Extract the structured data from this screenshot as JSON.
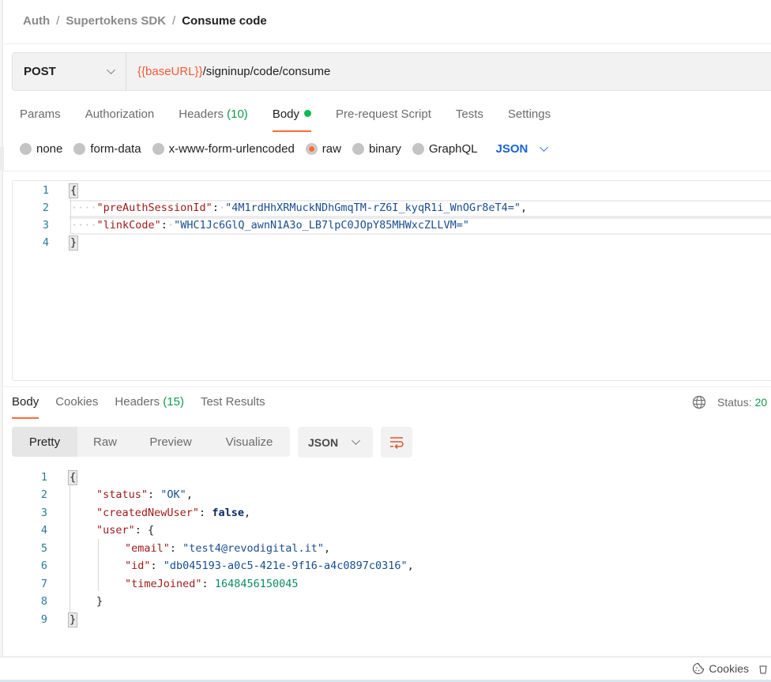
{
  "breadcrumb": {
    "items": [
      "Auth",
      "Supertokens SDK"
    ],
    "separator": "/",
    "current": "Consume code"
  },
  "request": {
    "method": "POST",
    "url_variable": "{{baseURL}}",
    "url_path": "/signinup/code/consume"
  },
  "request_tabs": [
    {
      "label": "Params"
    },
    {
      "label": "Authorization"
    },
    {
      "label": "Headers",
      "count": "(10)"
    },
    {
      "label": "Body",
      "active": true,
      "indicator": "green-dot"
    },
    {
      "label": "Pre-request Script"
    },
    {
      "label": "Tests"
    },
    {
      "label": "Settings"
    }
  ],
  "body_types": {
    "options": [
      "none",
      "form-data",
      "x-www-form-urlencoded",
      "raw",
      "binary",
      "GraphQL"
    ],
    "selected": "raw",
    "language": "JSON"
  },
  "request_body": {
    "lines": [
      {
        "n": "1",
        "open": "{"
      },
      {
        "n": "2",
        "key": "\"preAuthSessionId\"",
        "value": "\"4M1rdHhXRMuckNDhGmqTM-rZ6I_kyqR1i_WnOGr8eT4=\"",
        "trail": ","
      },
      {
        "n": "3",
        "key": "\"linkCode\"",
        "value": "\"WHC1Jc6GlQ_awnN1A3o_LB7lpC0JOpY85MHWxcZLLVM=\"",
        "trail": ""
      },
      {
        "n": "4",
        "close": "}"
      }
    ]
  },
  "response_tabs": [
    {
      "label": "Body",
      "active": true
    },
    {
      "label": "Cookies"
    },
    {
      "label": "Headers",
      "count": "(15)"
    },
    {
      "label": "Test Results"
    }
  ],
  "response_status": {
    "label": "Status:",
    "value": "20"
  },
  "response_view": {
    "modes": [
      "Pretty",
      "Raw",
      "Preview",
      "Visualize"
    ],
    "selected": "Pretty",
    "format": "JSON"
  },
  "response_body": {
    "lines": [
      {
        "n": "1",
        "text": "{"
      },
      {
        "n": "2",
        "key": "\"status\"",
        "value": "\"OK\"",
        "type": "str",
        "trail": ","
      },
      {
        "n": "3",
        "key": "\"createdNewUser\"",
        "value": "false",
        "type": "bool",
        "trail": ","
      },
      {
        "n": "4",
        "key": "\"user\"",
        "value": "{",
        "type": "brace",
        "trail": ""
      },
      {
        "n": "5",
        "key": "\"email\"",
        "value": "\"test4@revodigital.it\"",
        "type": "str",
        "trail": ","
      },
      {
        "n": "6",
        "key": "\"id\"",
        "value": "\"db045193-a0c5-421e-9f16-a4c0897c0316\"",
        "type": "str",
        "trail": ","
      },
      {
        "n": "7",
        "key": "\"timeJoined\"",
        "value": "1648456150045",
        "type": "num",
        "trail": ""
      },
      {
        "n": "8",
        "text": "}"
      },
      {
        "n": "9",
        "text": "}"
      }
    ]
  },
  "footer": {
    "cookies_label": "Cookies"
  },
  "colors": {
    "accent": "#ff6c37",
    "variable": "#f05a3a",
    "success": "#0f9a4a",
    "link_blue": "#1a64d6"
  }
}
